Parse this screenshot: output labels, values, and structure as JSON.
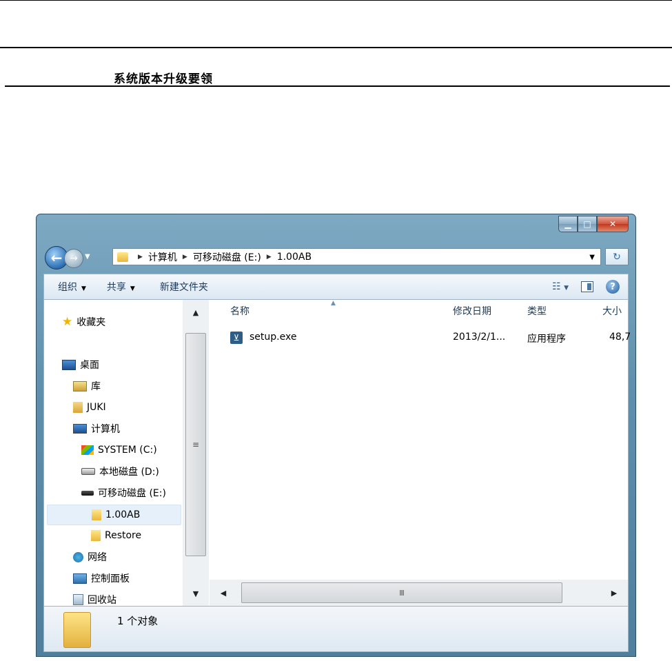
{
  "document": {
    "title": "系统版本升级要领"
  },
  "window": {
    "address": {
      "crumbs": [
        "计算机",
        "可移动磁盘 (E:)",
        "1.00AB"
      ]
    },
    "toolbar": {
      "organize": "组织",
      "share": "共享",
      "new_folder": "新建文件夹"
    },
    "nav": {
      "items": [
        {
          "label": "收藏夹",
          "icon": "star-icon"
        },
        {
          "label": "桌面",
          "icon": "desktop-icon"
        },
        {
          "label": "库",
          "icon": "library-icon"
        },
        {
          "label": "JUKI",
          "icon": "user-folder-icon"
        },
        {
          "label": "计算机",
          "icon": "computer-icon"
        },
        {
          "label": "SYSTEM (C:)",
          "icon": "system-drive-icon"
        },
        {
          "label": "本地磁盘 (D:)",
          "icon": "hard-disk-icon"
        },
        {
          "label": "可移动磁盘 (E:)",
          "icon": "removable-disk-icon"
        },
        {
          "label": "1.00AB",
          "icon": "folder-icon"
        },
        {
          "label": "Restore",
          "icon": "folder-icon"
        },
        {
          "label": "网络",
          "icon": "network-icon"
        },
        {
          "label": "控制面板",
          "icon": "control-panel-icon"
        },
        {
          "label": "回收站",
          "icon": "recycle-bin-icon"
        }
      ]
    },
    "columns": {
      "name": "名称",
      "modified": "修改日期",
      "type": "类型",
      "size": "大小"
    },
    "files": [
      {
        "name": "setup.exe",
        "modified": "2013/2/1...",
        "type": "应用程序",
        "size": "48,7"
      }
    ],
    "status": {
      "count": "1 个对象"
    },
    "scroll_marker": "Ⅲ",
    "vscroll_marker": "≡"
  }
}
